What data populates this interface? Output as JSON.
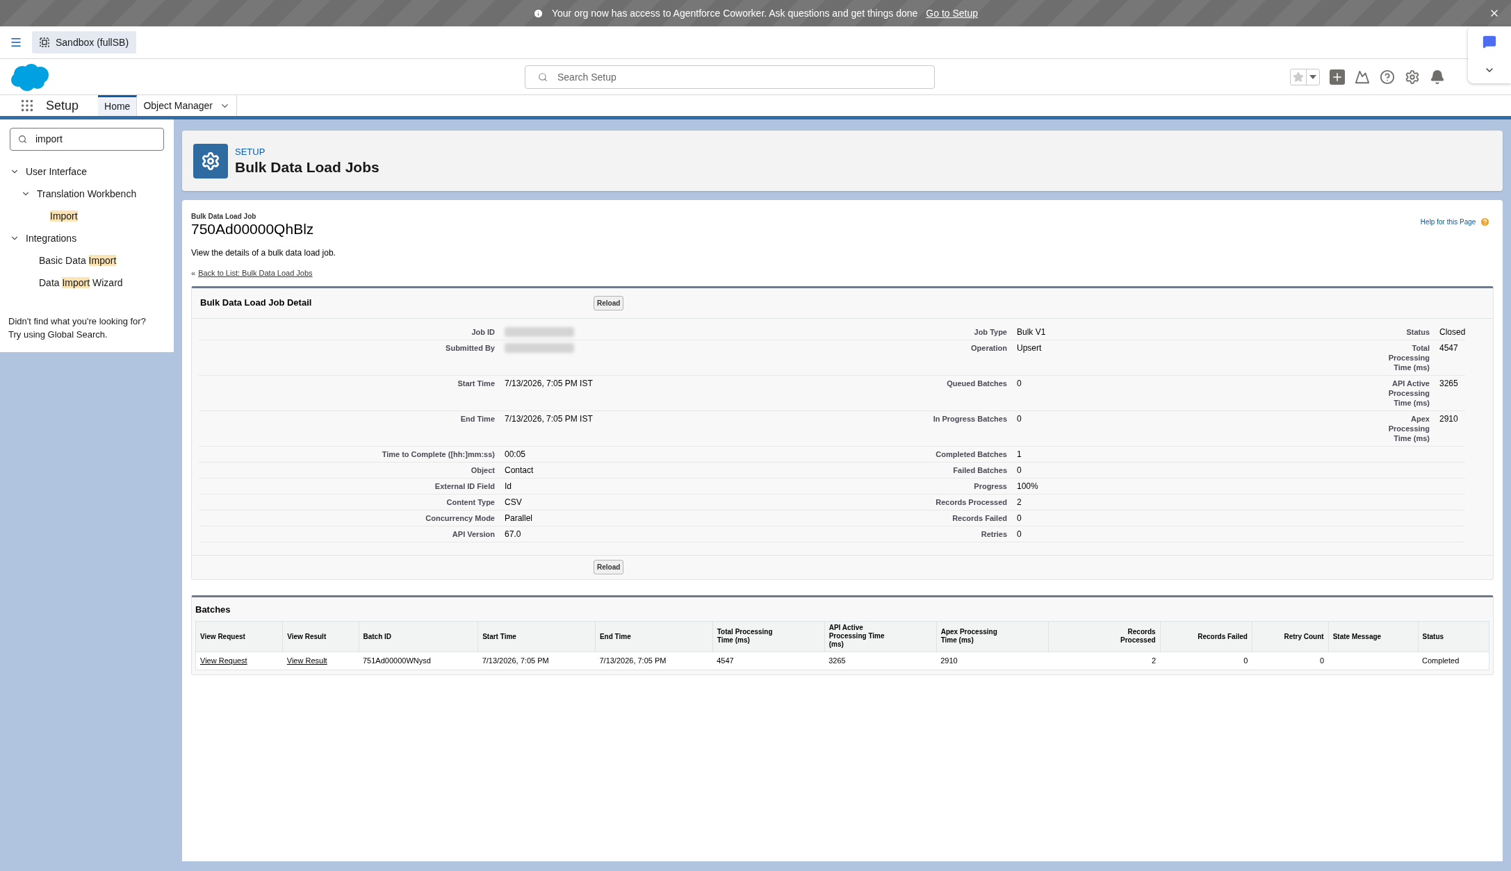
{
  "banner": {
    "message": "Your org now has access to Agentforce Coworker. Ask questions and get things done",
    "link": "Go to Setup"
  },
  "org": {
    "label": "Sandbox (fullSB)"
  },
  "search": {
    "placeholder": "Search Setup"
  },
  "nav": {
    "app": "Setup",
    "tabs": [
      {
        "label": "Home",
        "selected": true,
        "kind": "tab"
      },
      {
        "label": "Object Manager",
        "selected": false,
        "kind": "dropdown"
      }
    ]
  },
  "sidebar": {
    "search_value": "import",
    "tree": [
      {
        "parts": [
          {
            "text": "User Interface",
            "highlighted": false
          }
        ],
        "expanded": true,
        "children": [
          {
            "parts": [
              {
                "text": "Translation Workbench",
                "highlighted": false
              }
            ],
            "expanded": true,
            "children": [
              {
                "parts": [
                  {
                    "text": "Import",
                    "highlighted": true
                  }
                ]
              }
            ]
          }
        ]
      },
      {
        "parts": [
          {
            "text": "Integrations",
            "highlighted": false
          }
        ],
        "expanded": true,
        "children": [
          {
            "parts": [
              {
                "text": "Basic Data ",
                "highlighted": false
              },
              {
                "text": "Import",
                "highlighted": true
              }
            ]
          },
          {
            "parts": [
              {
                "text": "Data ",
                "highlighted": false
              },
              {
                "text": "Import",
                "highlighted": true
              },
              {
                "text": " Wizard",
                "highlighted": false
              }
            ]
          }
        ]
      }
    ],
    "hint_lines": [
      "Didn't find what you're looking for?",
      "Try using Global Search."
    ]
  },
  "header": {
    "eyebrow": "SETUP",
    "title": "Bulk Data Load Jobs"
  },
  "record": {
    "type": "Bulk Data Load Job",
    "id": "750Ad00000QhBlz",
    "help": "Help for this Page",
    "description": "View the details of a bulk data load job.",
    "back_prefix": "«",
    "back_link": "Back to List: Bulk Data Load Jobs"
  },
  "detail": {
    "title": "Bulk Data Load Job Detail",
    "reload_top": "Reload",
    "reload_bottom": "Reload",
    "rows": [
      [
        {
          "label": "Job ID",
          "kind": "redacted"
        },
        {
          "label": "Job Type",
          "value": "Bulk V1",
          "kind": "text"
        },
        {
          "label": "Status",
          "value": "Closed",
          "kind": "text"
        }
      ],
      [
        {
          "label": "Submitted By",
          "kind": "redacted"
        },
        {
          "label": "Operation",
          "value": "Upsert",
          "kind": "text"
        },
        {
          "label": "Total Processing Time (ms)",
          "value": "4547",
          "kind": "text"
        }
      ],
      [
        {
          "label": "Start Time",
          "value": "7/13/2026, 7:05 PM IST",
          "kind": "text"
        },
        {
          "label": "Queued Batches",
          "value": "0",
          "kind": "text"
        },
        {
          "label": "API Active Processing Time (ms)",
          "value": "3265",
          "kind": "text"
        }
      ],
      [
        {
          "label": "End Time",
          "value": "7/13/2026, 7:05 PM IST",
          "kind": "text"
        },
        {
          "label": "In Progress Batches",
          "value": "0",
          "kind": "text"
        },
        {
          "label": "Apex Processing Time (ms)",
          "value": "2910",
          "kind": "text"
        }
      ],
      [
        {
          "label": "Time to Complete ([hh:]mm:ss)",
          "value": "00:05",
          "kind": "text"
        },
        {
          "label": "Completed Batches",
          "value": "1",
          "kind": "text"
        }
      ],
      [
        {
          "label": "Object",
          "value": "Contact",
          "kind": "text"
        },
        {
          "label": "Failed Batches",
          "value": "0",
          "kind": "text"
        }
      ],
      [
        {
          "label": "External ID Field",
          "value": "Id",
          "kind": "text"
        },
        {
          "label": "Progress",
          "value": "100%",
          "kind": "text"
        }
      ],
      [
        {
          "label": "Content Type",
          "value": "CSV",
          "kind": "text"
        },
        {
          "label": "Records Processed",
          "value": "2",
          "kind": "text"
        }
      ],
      [
        {
          "label": "Concurrency Mode",
          "value": "Parallel",
          "kind": "text"
        },
        {
          "label": "Records Failed",
          "value": "0",
          "kind": "text"
        }
      ],
      [
        {
          "label": "API Version",
          "value": "67.0",
          "kind": "text"
        },
        {
          "label": "Retries",
          "value": "0",
          "kind": "text"
        }
      ]
    ]
  },
  "batches": {
    "title": "Batches",
    "columns": [
      {
        "label": "View Request",
        "kind": "link"
      },
      {
        "label": "View Result",
        "kind": "link"
      },
      {
        "label": "Batch ID",
        "kind": "text"
      },
      {
        "label": "Start Time",
        "kind": "text"
      },
      {
        "label": "End Time",
        "kind": "text"
      },
      {
        "label": "Total Processing Time (ms)",
        "kind": "text"
      },
      {
        "label": "API Active Processing Time (ms)",
        "kind": "text"
      },
      {
        "label": "Apex Processing Time (ms)",
        "kind": "text"
      },
      {
        "label": "Records Processed",
        "kind": "number"
      },
      {
        "label": "Records Failed",
        "kind": "number"
      },
      {
        "label": "Retry Count",
        "kind": "number"
      },
      {
        "label": "State Message",
        "kind": "text"
      },
      {
        "label": "Status",
        "kind": "text"
      }
    ],
    "rows": [
      [
        "View Request",
        "View Result",
        "751Ad00000WNysd",
        "7/13/2026, 7:05 PM",
        "7/13/2026, 7:05 PM",
        "4547",
        "3265",
        "2910",
        "2",
        "0",
        "0",
        "",
        "Completed"
      ]
    ]
  }
}
